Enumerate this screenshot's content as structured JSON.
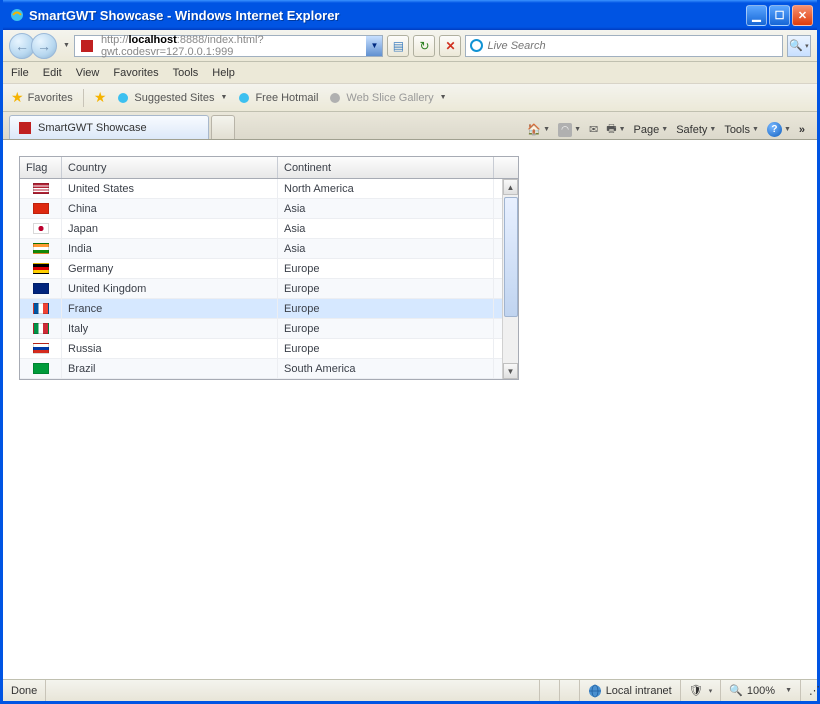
{
  "window": {
    "title": "SmartGWT Showcase - Windows Internet Explorer"
  },
  "address": {
    "url_prefix": "http://",
    "url_host": "localhost",
    "url_rest": ":8888/index.html?gwt.codesvr=127.0.0.1:999"
  },
  "search": {
    "placeholder": "Live Search"
  },
  "menu": {
    "file": "File",
    "edit": "Edit",
    "view": "View",
    "favorites": "Favorites",
    "tools": "Tools",
    "help": "Help"
  },
  "favbar": {
    "favorites": "Favorites",
    "suggested": "Suggested Sites",
    "hotmail": "Free Hotmail",
    "webslice": "Web Slice Gallery"
  },
  "tab": {
    "label": "SmartGWT Showcase"
  },
  "cmdbar": {
    "page": "Page",
    "safety": "Safety",
    "tools": "Tools"
  },
  "grid": {
    "headers": {
      "flag": "Flag",
      "country": "Country",
      "continent": "Continent"
    },
    "selected_index": 6,
    "rows": [
      {
        "country": "United States",
        "continent": "North America",
        "flag": "us"
      },
      {
        "country": "China",
        "continent": "Asia",
        "flag": "cn"
      },
      {
        "country": "Japan",
        "continent": "Asia",
        "flag": "jp"
      },
      {
        "country": "India",
        "continent": "Asia",
        "flag": "in"
      },
      {
        "country": "Germany",
        "continent": "Europe",
        "flag": "de"
      },
      {
        "country": "United Kingdom",
        "continent": "Europe",
        "flag": "gb"
      },
      {
        "country": "France",
        "continent": "Europe",
        "flag": "fr"
      },
      {
        "country": "Italy",
        "continent": "Europe",
        "flag": "it"
      },
      {
        "country": "Russia",
        "continent": "Europe",
        "flag": "ru"
      },
      {
        "country": "Brazil",
        "continent": "South America",
        "flag": "br"
      }
    ]
  },
  "status": {
    "done": "Done",
    "zone": "Local intranet",
    "zoom": "100%"
  },
  "flag_styles": {
    "us": "background:linear-gradient(to bottom,#b22234 0 15%,#fff 15% 30%,#b22234 30% 45%,#fff 45% 60%,#b22234 60% 75%,#fff 75% 90%,#b22234 90% 100%);position:relative;",
    "cn": "background:#de2910;",
    "jp": "background:radial-gradient(circle at 50% 50%,#bc002d 0 30%,#fff 32% 100%);",
    "in": "background:linear-gradient(to bottom,#ff9933 0 33%,#fff 33% 66%,#138808 66% 100%);",
    "de": "background:linear-gradient(to bottom,#000 0 33%,#dd0000 33% 66%,#ffce00 66% 100%);",
    "gb": "background:#00247d;position:relative;",
    "fr": "background:linear-gradient(to right,#0055a4 0 33%,#fff 33% 66%,#ef4135 66% 100%);",
    "it": "background:linear-gradient(to right,#009246 0 33%,#fff 33% 66%,#ce2b37 66% 100%);",
    "ru": "background:linear-gradient(to bottom,#fff 0 33%,#0039a6 33% 66%,#d52b1e 66% 100%);",
    "br": "background:#009b3a;position:relative;"
  }
}
